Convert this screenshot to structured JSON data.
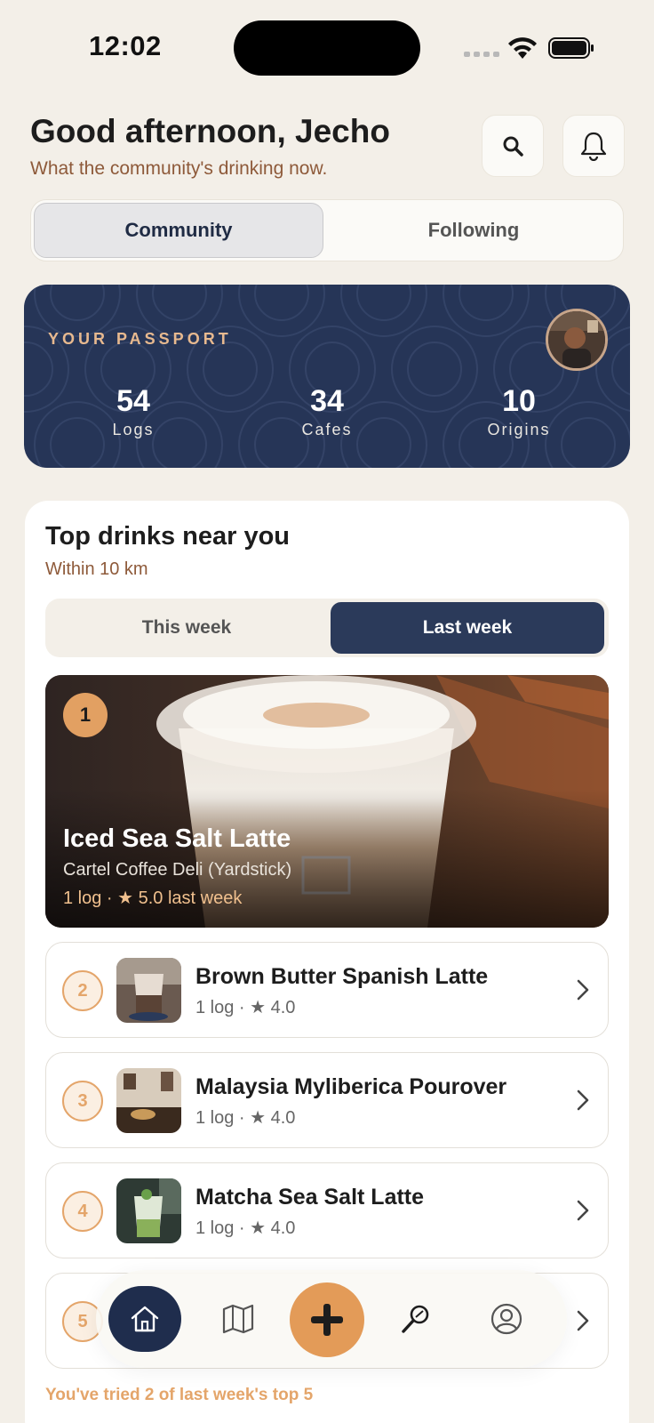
{
  "status_bar": {
    "time": "12:02"
  },
  "header": {
    "greeting": "Good afternoon, Jecho",
    "subtitle": "What the community's drinking now.",
    "search_icon": "search-icon",
    "bell_icon": "bell-icon"
  },
  "feed_tabs": {
    "active": "Community",
    "inactive": "Following"
  },
  "passport": {
    "label": "YOUR PASSPORT",
    "stats": [
      {
        "value": "54",
        "label": "Logs"
      },
      {
        "value": "34",
        "label": "Cafes"
      },
      {
        "value": "10",
        "label": "Origins"
      }
    ]
  },
  "top_drinks": {
    "title": "Top drinks near you",
    "subtitle": "Within 10 km",
    "period_tabs": {
      "inactive": "This week",
      "active": "Last week"
    },
    "hero": {
      "rank": "1",
      "name": "Iced Sea Salt Latte",
      "cafe": "Cartel Coffee Deli (Yardstick)",
      "meta": "1 log · ★ 5.0 last week"
    },
    "items": [
      {
        "rank": "2",
        "name": "Brown Butter Spanish Latte",
        "meta": "1 log · ★ 4.0"
      },
      {
        "rank": "3",
        "name": "Malaysia Myliberica Pourover",
        "meta": "1 log · ★ 4.0"
      },
      {
        "rank": "4",
        "name": "Matcha Sea Salt Latte",
        "meta": "1 log · ★ 4.0"
      },
      {
        "rank": "5",
        "name": "",
        "meta": ""
      }
    ],
    "tried_note": "You've tried 2 of last week's top 5"
  },
  "bottom_nav": {
    "items": [
      "home-icon",
      "map-icon",
      "add-icon",
      "explore-icon",
      "profile-icon"
    ],
    "active": "home-icon"
  },
  "colors": {
    "background": "#f3efe8",
    "navy": "#263557",
    "accent": "#e39b58",
    "brown_text": "#8e5a3a"
  }
}
